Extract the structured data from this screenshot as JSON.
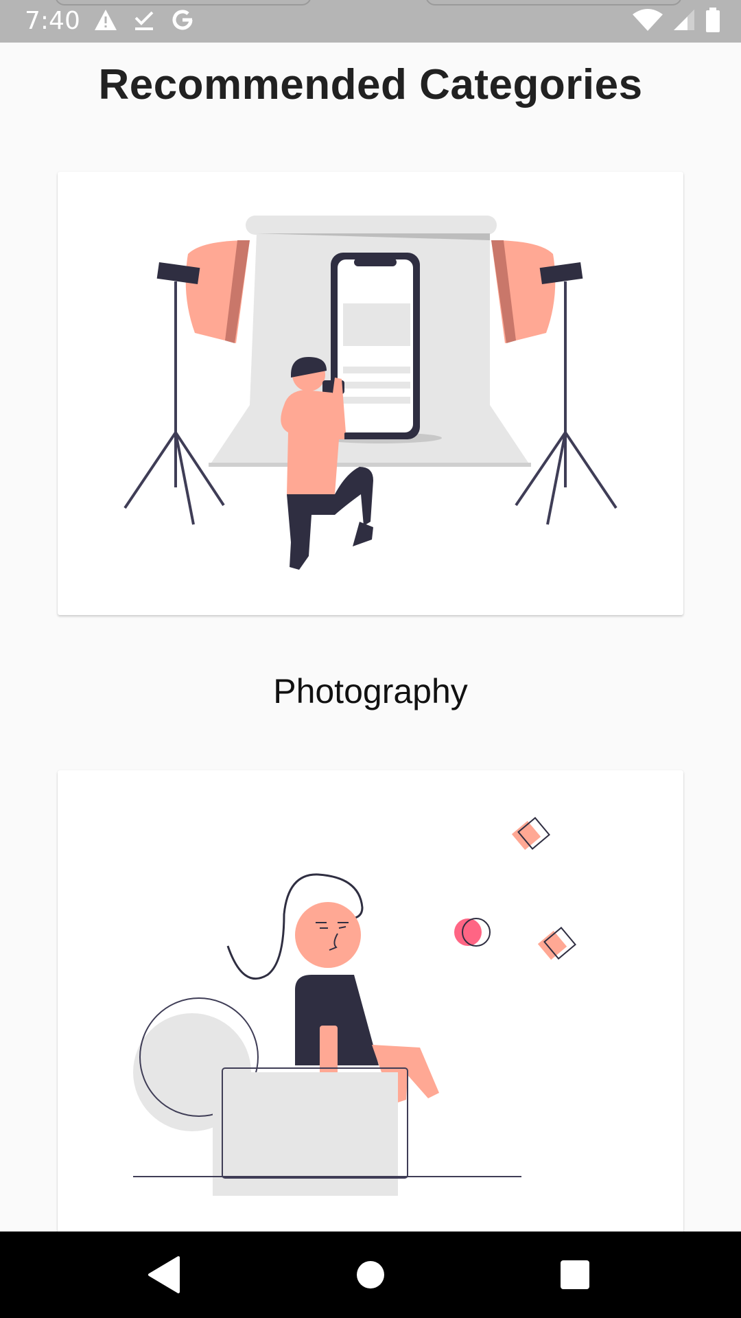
{
  "status_bar": {
    "time": "7:40",
    "left_icons": [
      "warning-icon",
      "download-done-icon",
      "google-icon"
    ],
    "right_icons": [
      "wifi-icon",
      "cell-signal-icon",
      "battery-icon"
    ]
  },
  "page": {
    "title": "Recommended Categories"
  },
  "categories": [
    {
      "label": "Photography",
      "illustration": "photographer-studio-illustration"
    },
    {
      "label": "",
      "illustration": "person-at-desk-illustration"
    }
  ],
  "nav_bar": {
    "buttons": [
      "back-icon",
      "home-icon",
      "recents-icon"
    ]
  },
  "colors": {
    "accent_peach": "#ffa894",
    "dark_navy": "#2f2e41",
    "light_gray": "#e6e6e6",
    "pink": "#ff6584"
  }
}
